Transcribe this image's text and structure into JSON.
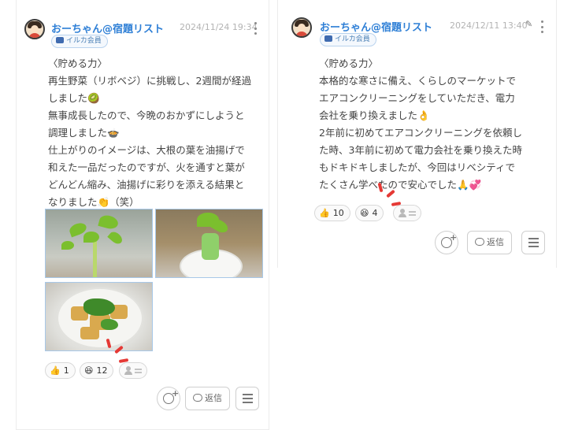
{
  "posts": [
    {
      "username": "おーちゃん@宿題リスト",
      "badge": "イルカ会員",
      "date": "2024/11/24 19:34",
      "body": "〈貯める力〉\n再生野菜（リボベジ）に挑戦し、2週間が経過\nしました🥝\n無事成長したので、今晩のおかずにしようと\n調理しました🍲\n仕上がりのイメージは、大根の葉を油揚げで\n和えた一品だったのですが、火を通すと葉が\nどんどん縮み、油揚げに彩りを添える結果と\nなりました👏（笑）",
      "reactions": [
        {
          "emoji": "👍",
          "count": "1"
        },
        {
          "emoji": "😆",
          "count": "12"
        }
      ],
      "reply_label": "返信"
    },
    {
      "username": "おーちゃん@宿題リスト",
      "badge": "イルカ会員",
      "date": "2024/12/11 13:40",
      "body": "〈貯める力〉\n本格的な寒さに備え、くらしのマーケットで\nエアコンクリーニングをしていただき、電力\n会社を乗り換えました👌\n2年前に初めてエアコンクリーニングを依頼し\nた時、3年前に初めて電力会社を乗り換えた時\nもドキドキしましたが、今回はリベシティで\nたくさん学べたので安心でした🙏💞",
      "reactions": [
        {
          "emoji": "👍",
          "count": "10"
        },
        {
          "emoji": "😆",
          "count": "4"
        }
      ],
      "reply_label": "返信"
    }
  ],
  "icons": {
    "avatar": "avatar-icon",
    "badge": "dolphin-badge-icon",
    "more": "kebab-menu-icon",
    "edit": "pencil-icon",
    "add_reaction": "add-reaction-icon",
    "reply": "speech-bubble-icon",
    "menu": "hamburger-menu-icon",
    "reactors": "reactors-list-icon"
  },
  "colors": {
    "username": "#2e7fd6",
    "date": "#b3b3b3",
    "highlight": "#e53935"
  }
}
